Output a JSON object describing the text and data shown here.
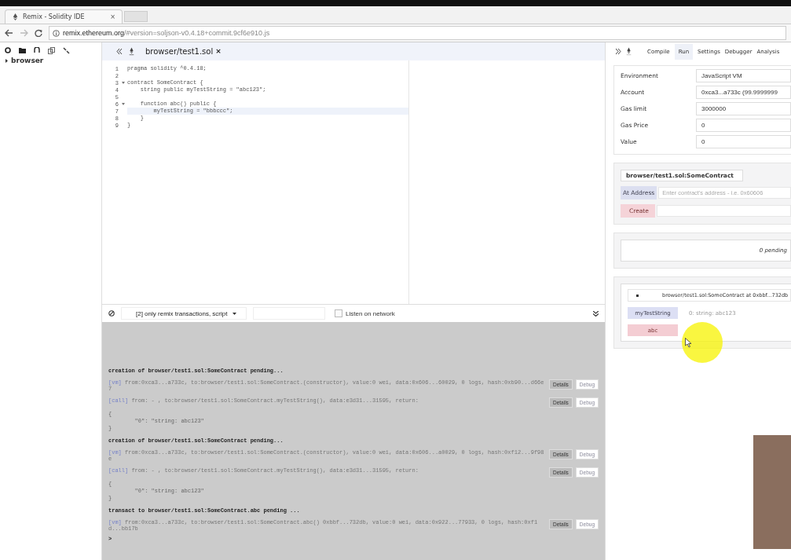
{
  "browser": {
    "tab_title": "Remix - Solidity IDE",
    "tab_close": "×",
    "url_host": "remix.ethereum.org",
    "url_path": "/#version=soljson-v0.4.18+commit.9cf6e910.js"
  },
  "file_explorer": {
    "items": [
      {
        "label": "browser",
        "expanded": false
      }
    ]
  },
  "editor": {
    "tabs": [
      {
        "label": "browser/test1.sol",
        "close": "×",
        "selected": true
      }
    ],
    "lines": [
      {
        "number": "1",
        "text": "pragma solidity ^0.4.18;"
      },
      {
        "number": "2"
      },
      {
        "number": "3",
        "text": "contract SomeContract {",
        "foldable": true
      },
      {
        "number": "4",
        "text": "    string public myTestString = \"abc123\";"
      },
      {
        "number": "5"
      },
      {
        "number": "6",
        "text": "    function abc() public {",
        "foldable": true
      },
      {
        "number": "7",
        "text": "        myTestString = \"bbbccc\";",
        "active": true
      },
      {
        "number": "8",
        "text": "    }"
      },
      {
        "number": "9",
        "text": "}"
      }
    ]
  },
  "terminal": {
    "filter": "[2] only remix transactions, script",
    "listen": {
      "label": "Listen on network",
      "checked": false
    },
    "entries": [
      {
        "kind": "pending",
        "text": "creation of browser/test1.sol:SomeContract pending..."
      },
      {
        "kind": "tx",
        "tag": "[vm]",
        "text": "from:0xca3...a733c, to:browser/test1.sol:SomeContract.(constructor), value:0 wei, data:0x606...60029, 0 logs, hash:0xb90...d66e7",
        "details": "Details",
        "debug": "Debug"
      },
      {
        "kind": "tx",
        "tag": "[call]",
        "text": "from: - , to:browser/test1.sol:SomeContract.myTestString(), data:e3d31...31595, return:",
        "details": "Details",
        "debug": "Debug"
      },
      {
        "kind": "return",
        "lines": [
          "{",
          "        \"0\": \"string: abc123\"",
          "}"
        ]
      },
      {
        "kind": "pending",
        "text": "creation of browser/test1.sol:SomeContract pending..."
      },
      {
        "kind": "tx",
        "tag": "[vm]",
        "text": "from:0xca3...a733c, to:browser/test1.sol:SomeContract.(constructor), value:0 wei, data:0x606...a0029, 0 logs, hash:0xf12...9f98e",
        "details": "Details",
        "debug": "Debug"
      },
      {
        "kind": "tx",
        "tag": "[call]",
        "text": "from: - , to:browser/test1.sol:SomeContract.myTestString(), data:e3d31...31595, return:",
        "details": "Details",
        "debug": "Debug"
      },
      {
        "kind": "return",
        "lines": [
          "{",
          "        \"0\": \"string: abc123\"",
          "}"
        ]
      },
      {
        "kind": "pending",
        "text": "transact to browser/test1.sol:SomeContract.abc pending ..."
      },
      {
        "kind": "tx",
        "tag": "[vm]",
        "text": "from:0xca3...a733c, to:browser/test1.sol:SomeContract.abc() 0xbbf...732db, value:0 wei, data:0x922...77933, 0 logs, hash:0xf1d...bb17b",
        "details": "Details",
        "debug": "Debug"
      }
    ],
    "prompt": ">"
  },
  "run_panel": {
    "tabs": [
      {
        "label": "Compile",
        "selected": false
      },
      {
        "label": "Run",
        "selected": true
      },
      {
        "label": "Settings",
        "selected": false
      },
      {
        "label": "Debugger",
        "selected": false
      },
      {
        "label": "Analysis",
        "selected": false
      }
    ],
    "settings": [
      {
        "label": "Environment",
        "value": "JavaScript VM"
      },
      {
        "label": "Account",
        "value": "0xca3...a733c (99.9999999"
      },
      {
        "label": "Gas limit",
        "value": "3000000"
      },
      {
        "label": "Gas Price",
        "value": "0"
      },
      {
        "label": "Value",
        "value": "0"
      }
    ],
    "contract_select": "browser/test1.sol:SomeContract",
    "at_address": {
      "label": "At Address",
      "placeholder": "Enter contract's address - i.e. 0x60606"
    },
    "create": {
      "label": "Create"
    },
    "pending": "0 pending",
    "instance": {
      "title": "browser/test1.sol:SomeContract at 0xbbf...732db",
      "functions": [
        {
          "label": "myTestString",
          "kind": "call",
          "result": "0: string: abc123"
        },
        {
          "label": "abc",
          "kind": "transact"
        }
      ]
    }
  }
}
